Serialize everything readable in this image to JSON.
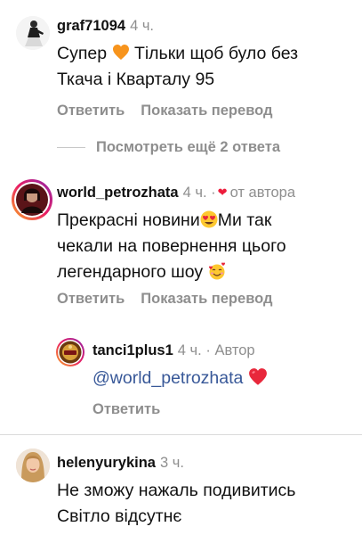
{
  "comments": [
    {
      "username": "graf71094",
      "time": "4 ч.",
      "text_line1_a": "Супер",
      "text_line1_b": "Тільки щоб було без",
      "text_line2": "Ткача і Кварталу 95",
      "reply_label": "Ответить",
      "translate_label": "Показать перевод"
    },
    {
      "username": "world_petrozhata",
      "time": "4 ч.",
      "separator": "·",
      "author_label": "от автора",
      "text_line1_a": "Прекрасні новини",
      "text_line1_b": "Ми так",
      "text_line2": "чекали на повернення цього",
      "text_line3": "легендарного шоу",
      "reply_label": "Ответить",
      "translate_label": "Показать перевод"
    },
    {
      "username": "helenyurykina",
      "time": "3 ч.",
      "text_line1": "Не зможу нажаль подивитись",
      "text_line2": "Світло відсутнє"
    }
  ],
  "more_replies": "Посмотреть ещё 2 ответа",
  "reply": {
    "username": "tanci1plus1",
    "time": "4 ч.",
    "separator": "·",
    "author_label": "Автор",
    "mention": "@world_petrozhata",
    "reply_label": "Ответить"
  },
  "colors": {
    "text": "#111111",
    "muted": "#8e8e8e",
    "mention": "#385898",
    "heart": "#ed1c3c"
  },
  "icons": [
    "orange-heart-icon",
    "heart-eyes-emoji-icon",
    "smiling-face-with-hearts-icon",
    "small-red-heart-icon",
    "red-heart-icon"
  ]
}
